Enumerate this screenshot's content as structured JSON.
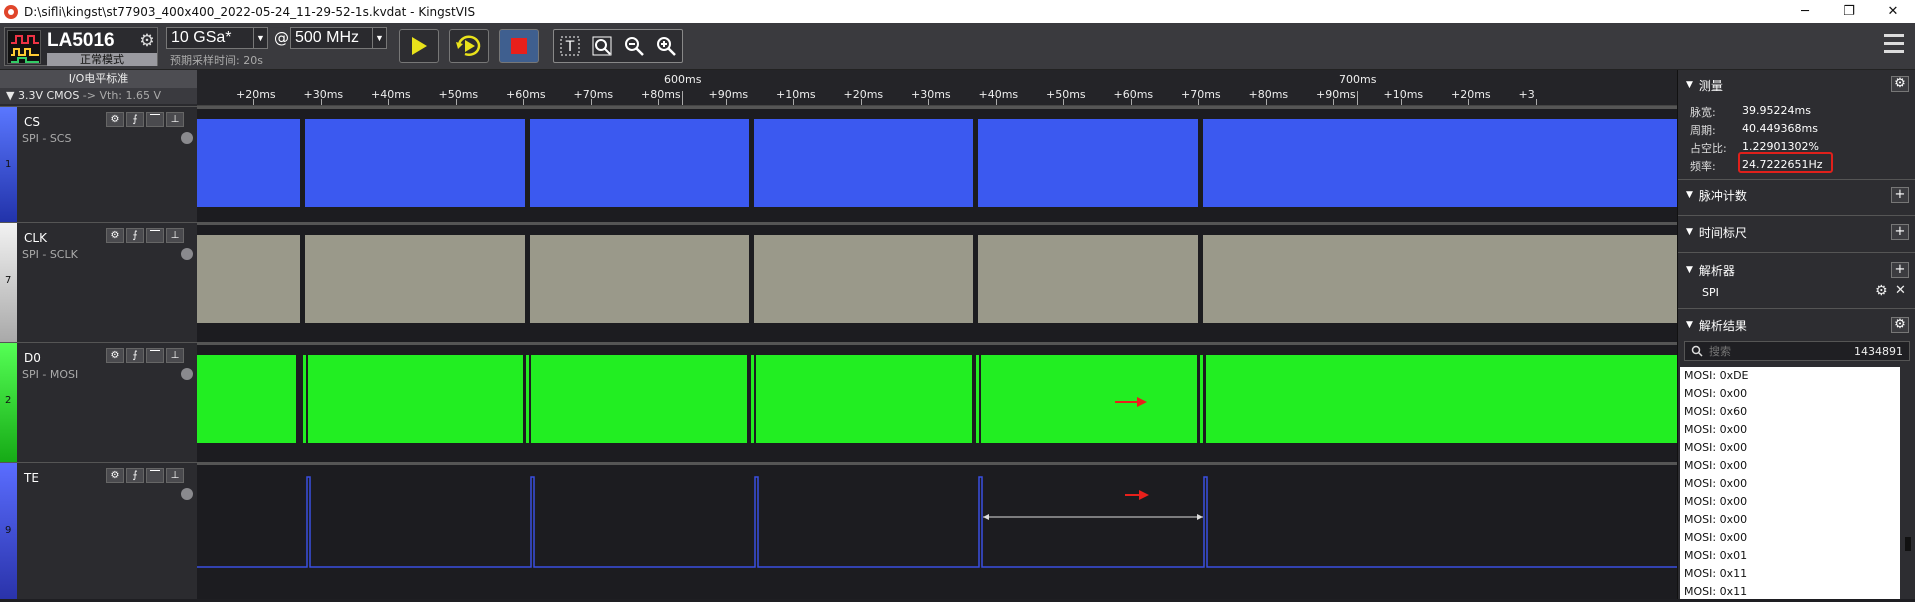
{
  "window": {
    "title": "D:\\sifli\\kingst\\st77903_400x400_2022-05-24_11-29-52-1s.kvdat - KingstVIS"
  },
  "toolbar": {
    "device_name": "LA5016",
    "device_mode": "正常模式",
    "sample_depth": "10 GSa*",
    "at_symbol": "@",
    "sample_rate": "500 MHz",
    "presample": "预期采样时间: 20s"
  },
  "io_standard": {
    "header": "I/O电平标准",
    "selected": "3.3V CMOS",
    "vth": "-> Vth: 1.65 V"
  },
  "ruler": {
    "minor_labels": [
      "+20ms",
      "+30ms",
      "+40ms",
      "+50ms",
      "+60ms",
      "+70ms",
      "+80ms",
      "+90ms",
      "+10ms",
      "+20ms",
      "+30ms",
      "+40ms",
      "+50ms",
      "+60ms",
      "+70ms",
      "+80ms",
      "+90ms",
      "+10ms",
      "+20ms",
      "+3"
    ],
    "major_labels": [
      "600ms",
      "700ms"
    ]
  },
  "channels": [
    {
      "index": "1",
      "name": "CS",
      "sub": "SPI - SCS",
      "color": "#3b59f0",
      "strip": "#3b59f0"
    },
    {
      "index": "7",
      "name": "CLK",
      "sub": "SPI - SCLK",
      "color": "#9a998a",
      "strip": "#e6e6e6"
    },
    {
      "index": "2",
      "name": "D0",
      "sub": "SPI - MOSI",
      "color": "#22ee22",
      "strip": "#22ee22"
    },
    {
      "index": "9",
      "name": "TE",
      "sub": "",
      "color": "#3a4ee0",
      "strip": "#3a4ee0"
    }
  ],
  "right_panel": {
    "measure": {
      "title": "测量",
      "rows": [
        {
          "label": "脉宽:",
          "value": "39.95224ms"
        },
        {
          "label": "周期:",
          "value": "40.449368ms"
        },
        {
          "label": "占空比:",
          "value": "1.22901302%"
        },
        {
          "label": "频率:",
          "value": "24.7222651Hz"
        }
      ]
    },
    "pulse_count": "脉冲计数",
    "time_ruler": "时间标尺",
    "analyzer": {
      "title": "解析器",
      "item": "SPI"
    },
    "decode_results": {
      "title": "解析结果",
      "search_placeholder": "搜索",
      "count": "1434891",
      "items": [
        "MOSI: 0xDE",
        "MOSI: 0x00",
        "MOSI: 0x60",
        "MOSI: 0x00",
        "MOSI: 0x00",
        "MOSI: 0x00",
        "MOSI: 0x00",
        "MOSI: 0x00",
        "MOSI: 0x00",
        "MOSI: 0x00",
        "MOSI: 0x01",
        "MOSI: 0x11",
        "MOSI: 0x11"
      ]
    }
  },
  "colors": {
    "highlight": "#e0201b",
    "arrow": "#e8201b"
  }
}
